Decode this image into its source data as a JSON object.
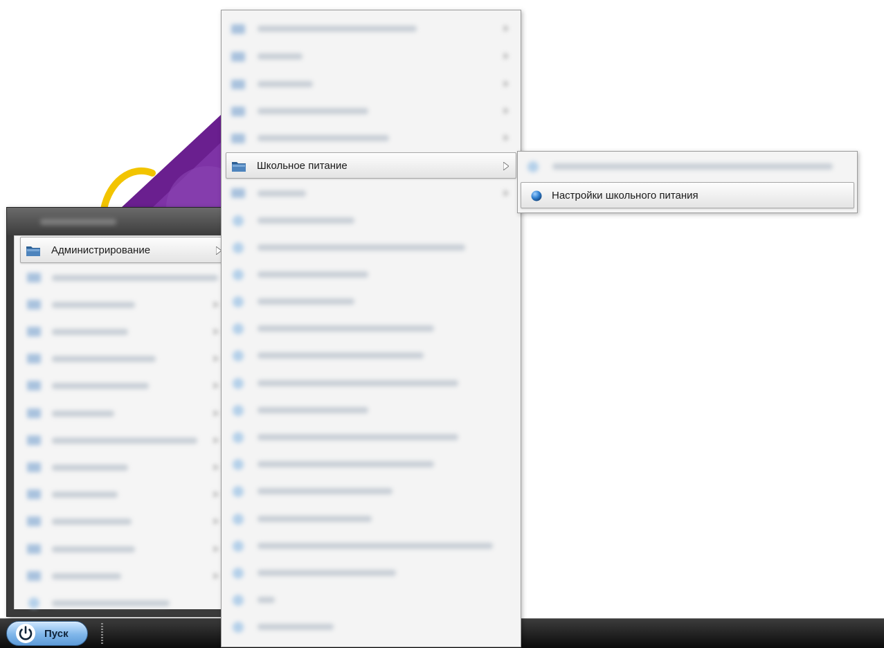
{
  "taskbar": {
    "start_label": "Пуск"
  },
  "main_menu": {
    "active_item_label": "Администрирование"
  },
  "submenu": {
    "active_item_label": "Школьное питание"
  },
  "submenu2": {
    "active_item_label": "Настройки школьного питания"
  },
  "icons": {
    "start": "power-icon",
    "folder": "folder-icon",
    "leaf": "blue-ball-icon",
    "submenu": "triangle-right-icon"
  },
  "colors": {
    "taskbar": "#1a1a1a",
    "start_button": "#7fb6ea",
    "menu_header": "#4a4a4a",
    "menu_body": "#f4f4f4",
    "folder_icon": "#3b6ea3",
    "leaf_icon": "#2f7fd0",
    "wallpaper_purple": "#6a1f8f",
    "wallpaper_yellow": "#f2c400"
  }
}
